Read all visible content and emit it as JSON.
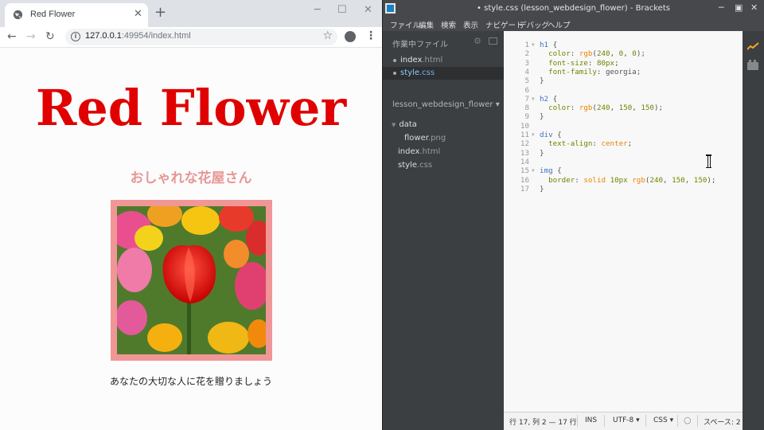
{
  "browser": {
    "tab_title": "Red Flower",
    "new_tab": "+",
    "tab_close": "✕",
    "url_host": "127.0.0.1",
    "url_rest": ":49954/index.html",
    "page": {
      "h1": "Red Flower",
      "h2": "おしゃれな花屋さん",
      "paragraph": "あなたの大切な人に花を贈りましょう"
    }
  },
  "brackets": {
    "title": "• style.css (lesson_webdesign_flower) - Brackets",
    "menu": [
      "ファイル",
      "編集",
      "検索",
      "表示",
      "ナビゲート",
      "デバッグ",
      "ヘルプ"
    ],
    "working_files_header": "作業中ファイル",
    "working_files": [
      {
        "base": "index",
        "ext": ".html",
        "selected": false
      },
      {
        "base": "style",
        "ext": ".css",
        "selected": true
      }
    ],
    "project_name": "lesson_webdesign_flower ▾",
    "tree": {
      "folder": "data",
      "folder_file_base": "flower",
      "folder_file_ext": ".png",
      "file1_base": "index",
      "file1_ext": ".html",
      "file2_base": "style",
      "file2_ext": ".css"
    },
    "code_lines": [
      [
        [
          "sel",
          "h1"
        ],
        [
          "punc",
          " {"
        ]
      ],
      [
        [
          "prop",
          "  color"
        ],
        [
          "punc",
          ": "
        ],
        [
          "valstr",
          "rgb"
        ],
        [
          "punc",
          "("
        ],
        [
          "num",
          "240"
        ],
        [
          "punc",
          ", "
        ],
        [
          "num",
          "0"
        ],
        [
          "punc",
          ", "
        ],
        [
          "num",
          "0"
        ],
        [
          "punc",
          ");"
        ]
      ],
      [
        [
          "prop",
          "  font-size"
        ],
        [
          "punc",
          ": "
        ],
        [
          "num",
          "80px"
        ],
        [
          "punc",
          ";"
        ]
      ],
      [
        [
          "prop",
          "  font-family"
        ],
        [
          "punc",
          ": georgia;"
        ]
      ],
      [
        [
          "punc",
          "}"
        ]
      ],
      [],
      [
        [
          "sel",
          "h2"
        ],
        [
          "punc",
          " {"
        ]
      ],
      [
        [
          "prop",
          "  color"
        ],
        [
          "punc",
          ": "
        ],
        [
          "valstr",
          "rgb"
        ],
        [
          "punc",
          "("
        ],
        [
          "num",
          "240"
        ],
        [
          "punc",
          ", "
        ],
        [
          "num",
          "150"
        ],
        [
          "punc",
          ", "
        ],
        [
          "num",
          "150"
        ],
        [
          "punc",
          ");"
        ]
      ],
      [
        [
          "punc",
          "}"
        ]
      ],
      [],
      [
        [
          "sel",
          "div"
        ],
        [
          "punc",
          " {"
        ]
      ],
      [
        [
          "prop",
          "  text-align"
        ],
        [
          "punc",
          ": "
        ],
        [
          "valstr",
          "center"
        ],
        [
          "punc",
          ";"
        ]
      ],
      [
        [
          "punc",
          "}"
        ]
      ],
      [],
      [
        [
          "sel",
          "img"
        ],
        [
          "punc",
          " {"
        ]
      ],
      [
        [
          "prop",
          "  border"
        ],
        [
          "punc",
          ": "
        ],
        [
          "valstr",
          "solid"
        ],
        [
          "punc",
          " "
        ],
        [
          "num",
          "10px"
        ],
        [
          "punc",
          " "
        ],
        [
          "valstr",
          "rgb"
        ],
        [
          "punc",
          "("
        ],
        [
          "num",
          "240"
        ],
        [
          "punc",
          ", "
        ],
        [
          "num",
          "150"
        ],
        [
          "punc",
          ", "
        ],
        [
          "num",
          "150"
        ],
        [
          "punc",
          ");"
        ]
      ],
      [
        [
          "punc",
          "}"
        ]
      ]
    ],
    "fold_lines": [
      1,
      7,
      11,
      15
    ],
    "status": {
      "position": "行 17, 列 2 — 17 行",
      "ins": "INS",
      "encoding": "UTF-8 ▾",
      "language": "CSS ▾",
      "spaces": "スペース: 2"
    }
  }
}
